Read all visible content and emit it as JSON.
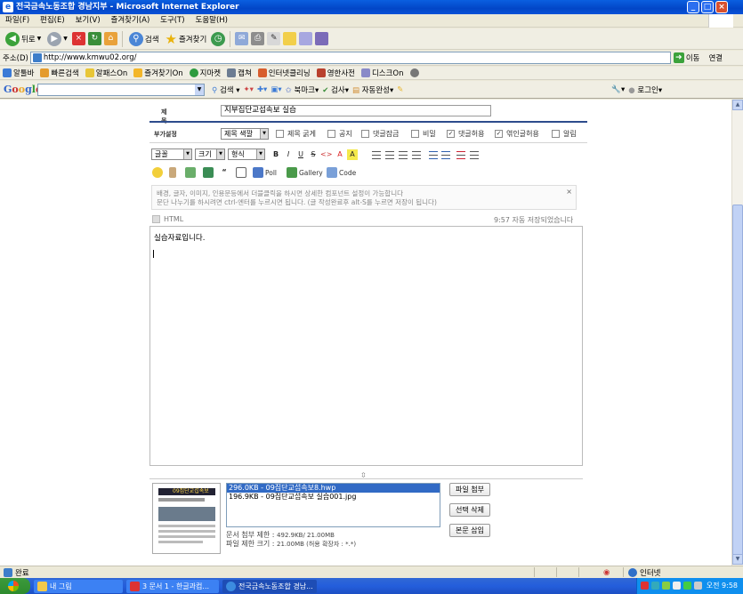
{
  "window": {
    "title": "전국금속노동조합 경남지부 - Microsoft Internet Explorer"
  },
  "menu": [
    "파일(F)",
    "편집(E)",
    "보기(V)",
    "즐겨찾기(A)",
    "도구(T)",
    "도움말(H)"
  ],
  "toolbar": {
    "back": "뒤로",
    "search": "검색",
    "favorites": "즐겨찾기"
  },
  "address": {
    "label": "주소(D)",
    "url": "http://www.kmwu02.org/",
    "go": "이동",
    "links": "연결"
  },
  "linksbar": [
    "알툴바",
    "빠른검색",
    "알패스On",
    "즐겨찾기On",
    "지마켓",
    "캡쳐",
    "인터넷클리닝",
    "영한사전",
    "디스크On"
  ],
  "googlebar": {
    "logo": "Google",
    "search": "검색",
    "bookmarks": "북마크",
    "check": "검사",
    "autofill": "자동완성",
    "login": "로그인"
  },
  "form": {
    "title_label": "제목",
    "title_value": "지부집단교섭속보 실습",
    "options_label": "부가설정",
    "title_color": "제목 색깔",
    "options": [
      {
        "label": "제목 굵게",
        "checked": false
      },
      {
        "label": "공지",
        "checked": false
      },
      {
        "label": "댓글잠금",
        "checked": false
      },
      {
        "label": "비밀",
        "checked": false
      },
      {
        "label": "댓글허용",
        "checked": true
      },
      {
        "label": "엮인글허용",
        "checked": true
      },
      {
        "label": "알림",
        "checked": false
      }
    ]
  },
  "editor": {
    "font": "글꼴",
    "size": "크기",
    "format": "형식",
    "bold": "B",
    "italic": "I",
    "underline": "U",
    "strike": "S",
    "code_tag": "<>",
    "font_color": "A",
    "bg_color": "A",
    "poll": "Poll",
    "gallery": "Gallery",
    "code": "Code",
    "hint_line1": "배경, 글자, 이미지, 인용문등에서 더블클릭을 하시면 상세한 컴포넌트 설정이 가능합니다",
    "hint_line2": "문단 나누기를 하시려면 ctrl-엔터를 누르시면 됩니다. (글 작성완료후 alt-S를 누르면 저장이 됩니다)",
    "hint_close": "×",
    "html_label": "HTML",
    "autosave": "9:57 자동 저장되었습니다",
    "content": "실습자료입니다."
  },
  "attachments": {
    "files": [
      {
        "label": "296.0KB - 09집단교섭속보8.hwp",
        "selected": true
      },
      {
        "label": "196.9KB - 09집단교섭속보 실습001.jpg",
        "selected": false
      }
    ],
    "thumb_title": "09집단교섭속보",
    "attach": "파일 첨부",
    "delete": "선택 삭제",
    "insert": "본문 삽입",
    "doc_limit_label": "문서 첨부 제한 :",
    "doc_limit_value": "492.9KB/ 21.00MB",
    "file_limit_label": "파일 제한 크기 :",
    "file_limit_value": "21.00MB (허용 확장자 : *.*)"
  },
  "status": {
    "text": "완료",
    "zone": "인터넷"
  },
  "taskbar": {
    "tasks": [
      {
        "label": "내 그림",
        "active": false
      },
      {
        "label": "3 문서 1 - 한글과컴...",
        "active": false
      },
      {
        "label": "전국금속노동조합 경남...",
        "active": true
      }
    ],
    "clock": "오전 9:58"
  },
  "colors": {
    "accent": "#2D4C8C",
    "titlebar": "#0A5FE0",
    "selection": "#316AC5"
  }
}
